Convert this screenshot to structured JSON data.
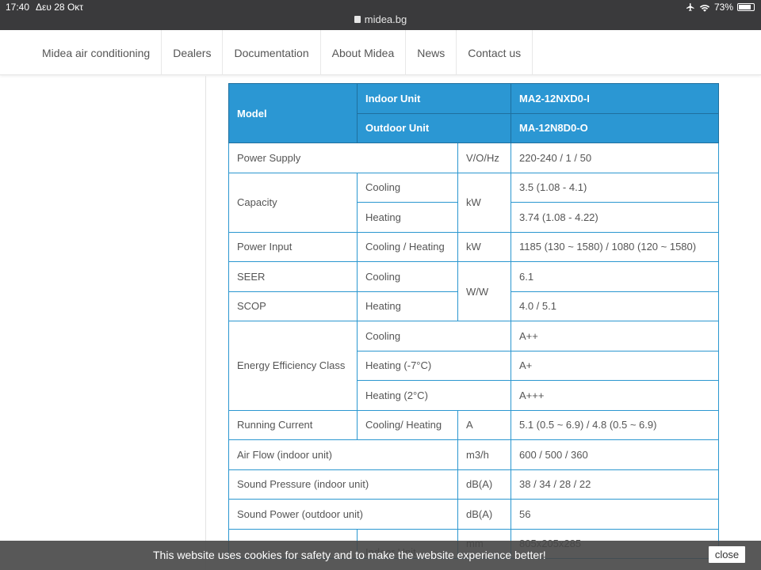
{
  "status_bar": {
    "time": "17:40",
    "date": "Δευ 28 Οκτ",
    "url": "midea.bg",
    "battery": "73%",
    "battery_level": 0.73,
    "airplane_icon": "airplane-icon",
    "wifi_icon": "wifi-icon"
  },
  "nav": {
    "items": [
      "Midea air conditioning",
      "Dealers",
      "Documentation",
      "About Midea",
      "News",
      "Contact us"
    ]
  },
  "table": {
    "model": "Model",
    "indoor_label": "Indoor Unit",
    "indoor_model": "MA2-12NXD0-I",
    "outdoor_label": "Outdoor Unit",
    "outdoor_model": "MA-12N8D0-O",
    "power_supply": {
      "label": "Power Supply",
      "unit": "V/O/Hz",
      "value": "220-240 / 1 / 50"
    },
    "capacity": {
      "label": "Capacity",
      "unit": "kW",
      "cooling_label": "Cooling",
      "cooling_value": "3.5 (1.08 - 4.1)",
      "heating_label": "Heating",
      "heating_value": "3.74 (1.08 - 4.22)"
    },
    "power_input": {
      "label": "Power Input",
      "mode": "Cooling / Heating",
      "unit": "kW",
      "value": "1185 (130 ~ 1580) / 1080 (120 ~ 1580)"
    },
    "seer": {
      "label": "SEER",
      "mode": "Cooling",
      "value": "6.1"
    },
    "scop": {
      "label": "SCOP",
      "mode": "Heating",
      "value": "4.0 / 5.1"
    },
    "ww_unit": "W/W",
    "energy": {
      "label": "Energy Efficiency Class",
      "cooling_label": "Cooling",
      "cooling_value": "A++",
      "heating7_label": "Heating (-7°C)",
      "heating7_value": "A+",
      "heating2_label": "Heating (2°C)",
      "heating2_value": "A+++"
    },
    "running_current": {
      "label": "Running Current",
      "mode": "Cooling/ Heating",
      "unit": "A",
      "value": "5.1 (0.5 ~ 6.9) / 4.8 (0.5 ~ 6.9)"
    },
    "air_flow": {
      "label": "Air Flow (indoor unit)",
      "unit": "m3/h",
      "value": "600 / 500 / 360"
    },
    "sound_pressure": {
      "label": "Sound Pressure (indoor unit)",
      "unit": "dB(A)",
      "value": "38 / 34 / 28 / 22"
    },
    "sound_power": {
      "label": "Sound Power (outdoor unit)",
      "unit": "dB(A)",
      "value": "56"
    },
    "dimensions": {
      "mode": "Indoor Unit",
      "unit": "mm",
      "value": "805x205x285"
    }
  },
  "cookie": {
    "text": "This website uses cookies for safety and to make the website experience better!",
    "close": "close"
  }
}
